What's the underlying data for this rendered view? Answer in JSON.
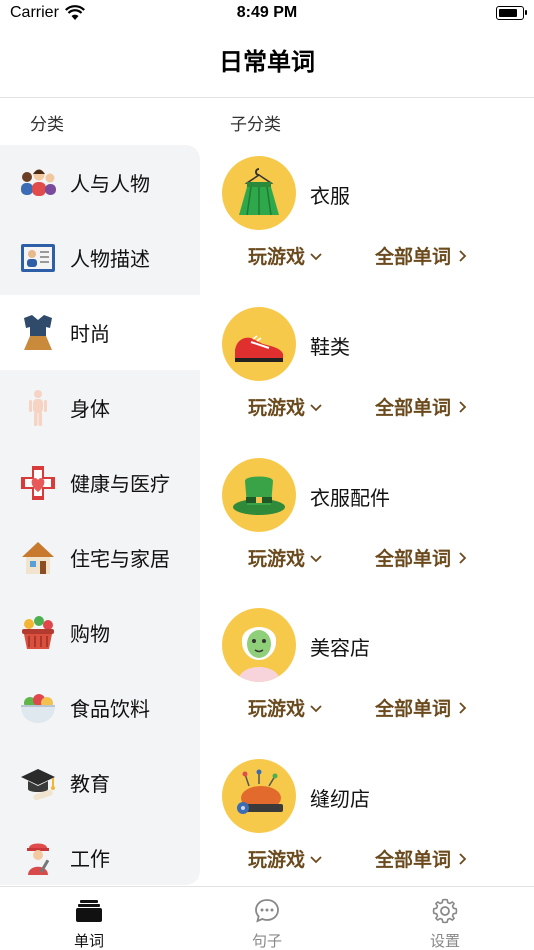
{
  "status": {
    "carrier": "Carrier",
    "time": "8:49 PM",
    "battery_level": 0.85
  },
  "nav": {
    "title": "日常单词"
  },
  "headers": {
    "category": "分类",
    "subcategory": "子分类"
  },
  "categories": [
    {
      "label": "人与人物",
      "icon": "people-icon"
    },
    {
      "label": "人物描述",
      "icon": "profile-card-icon"
    },
    {
      "label": "时尚",
      "icon": "clothing-icon",
      "selected": true
    },
    {
      "label": "身体",
      "icon": "body-icon"
    },
    {
      "label": "健康与医疗",
      "icon": "medical-cross-icon"
    },
    {
      "label": "住宅与家居",
      "icon": "house-icon"
    },
    {
      "label": "购物",
      "icon": "shopping-basket-icon"
    },
    {
      "label": "食品饮料",
      "icon": "food-bowl-icon"
    },
    {
      "label": "教育",
      "icon": "graduation-cap-icon"
    },
    {
      "label": "工作",
      "icon": "worker-icon"
    }
  ],
  "subcategories": [
    {
      "name": "衣服",
      "icon": "skirt-on-hanger-icon",
      "play_label": "玩游戏",
      "all_label": "全部单词"
    },
    {
      "name": "鞋类",
      "icon": "sneaker-icon",
      "play_label": "玩游戏",
      "all_label": "全部单词"
    },
    {
      "name": "衣服配件",
      "icon": "top-hat-icon",
      "play_label": "玩游戏",
      "all_label": "全部单词"
    },
    {
      "name": "美容店",
      "icon": "face-mask-icon",
      "play_label": "玩游戏",
      "all_label": "全部单词"
    },
    {
      "name": "缝纫店",
      "icon": "pincushion-icon",
      "play_label": "玩游戏",
      "all_label": "全部单词"
    }
  ],
  "tabs": [
    {
      "label": "单词",
      "icon": "cards-stack-icon",
      "active": true
    },
    {
      "label": "句子",
      "icon": "chat-bubble-icon"
    },
    {
      "label": "设置",
      "icon": "gear-icon"
    }
  ],
  "colors": {
    "accent_brown": "#6b4a1e",
    "circle_yellow": "#f7c94b",
    "sidebar_bg": "#f3f4f6"
  }
}
